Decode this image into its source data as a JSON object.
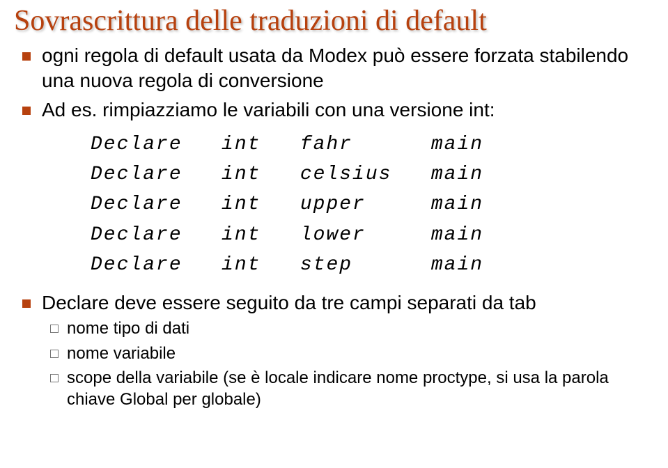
{
  "title": "Sovrascrittura delle traduzioni di default",
  "bullets": {
    "b1": "ogni regola di default usata da Modex può essere forzata stabilendo una nuova regola di conversione",
    "b2": "Ad es. rimpiazziamo le variabili con una versione int:",
    "b3": "Declare deve essere seguito da tre campi separati da tab"
  },
  "code": {
    "r1": "Declare   int   fahr      main",
    "r2": "Declare   int   celsius   main",
    "r3": "Declare   int   upper     main",
    "r4": "Declare   int   lower     main",
    "r5": "Declare   int   step      main"
  },
  "sub": {
    "s1": "nome tipo di dati",
    "s2": "nome variabile",
    "s3": "scope della variabile (se è locale indicare nome proctype, si usa la parola chiave Global per globale)"
  }
}
